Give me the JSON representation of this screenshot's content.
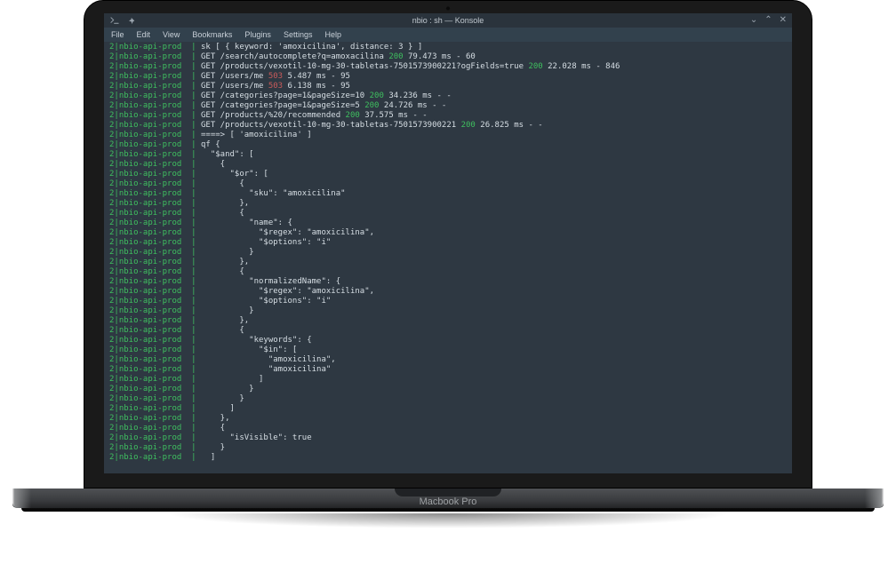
{
  "laptop_label": "Macbook Pro",
  "window": {
    "title": "nbio : sh — Konsole"
  },
  "menus": [
    "File",
    "Edit",
    "View",
    "Bookmarks",
    "Plugins",
    "Settings",
    "Help"
  ],
  "prefix": {
    "num": "2",
    "name": "nbio-api-prod",
    "bar": "|"
  },
  "lines": [
    {
      "segs": [
        {
          "t": "sk [ { keyword: 'amoxicilina', distance: 3 } ]"
        }
      ]
    },
    {
      "segs": [
        {
          "t": "GET /search/autocomplete?q=amoxacilina "
        },
        {
          "t": "200",
          "c": "status-200"
        },
        {
          "t": " 79.473 ms - 60"
        }
      ]
    },
    {
      "segs": [
        {
          "t": "GET /products/vexotil-10-mg-30-tabletas-7501573900221?ogFields=true "
        },
        {
          "t": "200",
          "c": "status-200"
        },
        {
          "t": " 22.028 ms - 846"
        }
      ]
    },
    {
      "segs": [
        {
          "t": "GET /users/me "
        },
        {
          "t": "503",
          "c": "status-503"
        },
        {
          "t": " 5.487 ms - 95"
        }
      ]
    },
    {
      "segs": [
        {
          "t": "GET /users/me "
        },
        {
          "t": "503",
          "c": "status-503"
        },
        {
          "t": " 6.138 ms - 95"
        }
      ]
    },
    {
      "segs": [
        {
          "t": "GET /categories?page=1&pageSize=10 "
        },
        {
          "t": "200",
          "c": "status-200"
        },
        {
          "t": " 34.236 ms - -"
        }
      ]
    },
    {
      "segs": [
        {
          "t": "GET /categories?page=1&pageSize=5 "
        },
        {
          "t": "200",
          "c": "status-200"
        },
        {
          "t": " 24.726 ms - -"
        }
      ]
    },
    {
      "segs": [
        {
          "t": "GET /products/%20/recommended "
        },
        {
          "t": "200",
          "c": "status-200"
        },
        {
          "t": " 37.575 ms - -"
        }
      ]
    },
    {
      "segs": [
        {
          "t": "GET /products/vexotil-10-mg-30-tabletas-7501573900221 "
        },
        {
          "t": "200",
          "c": "status-200"
        },
        {
          "t": " 26.825 ms - -"
        }
      ]
    },
    {
      "segs": [
        {
          "t": "====> [ 'amoxicilina' ]"
        }
      ]
    },
    {
      "segs": [
        {
          "t": "qf {"
        }
      ]
    },
    {
      "segs": [
        {
          "t": "  \"$and\": ["
        }
      ]
    },
    {
      "segs": [
        {
          "t": "    {"
        }
      ]
    },
    {
      "segs": [
        {
          "t": "      \"$or\": ["
        }
      ]
    },
    {
      "segs": [
        {
          "t": "        {"
        }
      ]
    },
    {
      "segs": [
        {
          "t": "          \"sku\": \"amoxicilina\""
        }
      ]
    },
    {
      "segs": [
        {
          "t": "        },"
        }
      ]
    },
    {
      "segs": [
        {
          "t": "        {"
        }
      ]
    },
    {
      "segs": [
        {
          "t": "          \"name\": {"
        }
      ]
    },
    {
      "segs": [
        {
          "t": "            \"$regex\": \"amoxicilina\","
        }
      ]
    },
    {
      "segs": [
        {
          "t": "            \"$options\": \"i\""
        }
      ]
    },
    {
      "segs": [
        {
          "t": "          }"
        }
      ]
    },
    {
      "segs": [
        {
          "t": "        },"
        }
      ]
    },
    {
      "segs": [
        {
          "t": "        {"
        }
      ]
    },
    {
      "segs": [
        {
          "t": "          \"normalizedName\": {"
        }
      ]
    },
    {
      "segs": [
        {
          "t": "            \"$regex\": \"amoxicilina\","
        }
      ]
    },
    {
      "segs": [
        {
          "t": "            \"$options\": \"i\""
        }
      ]
    },
    {
      "segs": [
        {
          "t": "          }"
        }
      ]
    },
    {
      "segs": [
        {
          "t": "        },"
        }
      ]
    },
    {
      "segs": [
        {
          "t": "        {"
        }
      ]
    },
    {
      "segs": [
        {
          "t": "          \"keywords\": {"
        }
      ]
    },
    {
      "segs": [
        {
          "t": "            \"$in\": ["
        }
      ]
    },
    {
      "segs": [
        {
          "t": "              \"amoxicilina\","
        }
      ]
    },
    {
      "segs": [
        {
          "t": "              \"amoxicilina\""
        }
      ]
    },
    {
      "segs": [
        {
          "t": "            ]"
        }
      ]
    },
    {
      "segs": [
        {
          "t": "          }"
        }
      ]
    },
    {
      "segs": [
        {
          "t": "        }"
        }
      ]
    },
    {
      "segs": [
        {
          "t": "      ]"
        }
      ]
    },
    {
      "segs": [
        {
          "t": "    },"
        }
      ]
    },
    {
      "segs": [
        {
          "t": "    {"
        }
      ]
    },
    {
      "segs": [
        {
          "t": "      \"isVisible\": true"
        }
      ]
    },
    {
      "segs": [
        {
          "t": "    }"
        }
      ]
    },
    {
      "segs": [
        {
          "t": "  ]"
        }
      ]
    }
  ]
}
